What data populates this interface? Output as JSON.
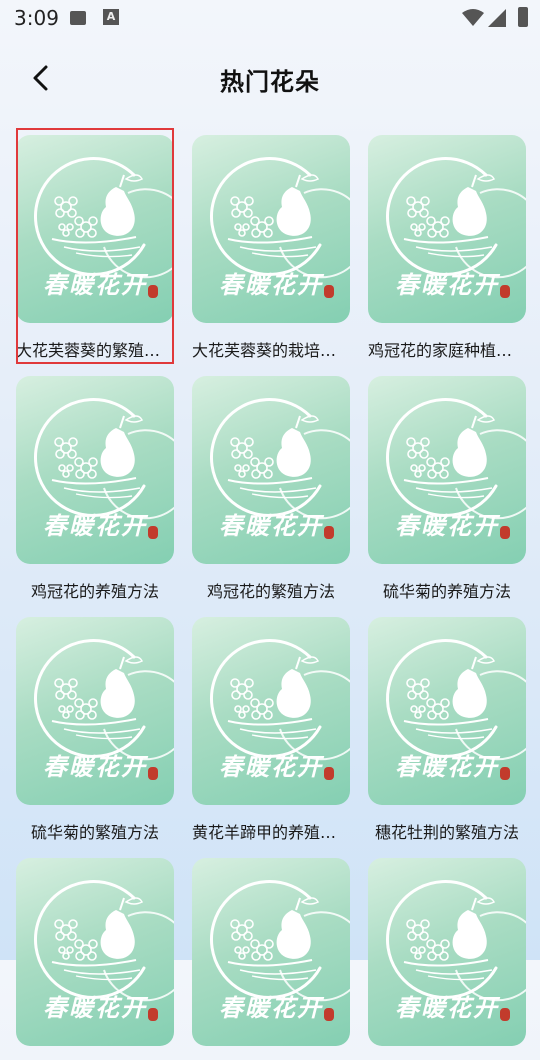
{
  "status_bar": {
    "time": "3:09",
    "icons": [
      "image-icon",
      "text-a-icon",
      "wifi-icon",
      "cell-signal-icon",
      "battery-charging-icon"
    ]
  },
  "header": {
    "title": "热门花朵",
    "back_icon": "back-arrow-icon"
  },
  "logo_text": "春暖花开",
  "items": [
    {
      "title": "大花芙蓉葵的繁殖方法",
      "selected": true
    },
    {
      "title": "大花芙蓉葵的栽培方法"
    },
    {
      "title": "鸡冠花的家庭种植方法"
    },
    {
      "title": "鸡冠花的养殖方法"
    },
    {
      "title": "鸡冠花的繁殖方法"
    },
    {
      "title": "硫华菊的养殖方法"
    },
    {
      "title": "硫华菊的繁殖方法"
    },
    {
      "title": "黄花羊蹄甲的养殖方法"
    },
    {
      "title": "穗花牡荆的繁殖方法"
    },
    {
      "title": ""
    },
    {
      "title": ""
    },
    {
      "title": ""
    }
  ],
  "colors": {
    "selection_border": "#e0393b",
    "thumb_green": "#84cfb2"
  }
}
